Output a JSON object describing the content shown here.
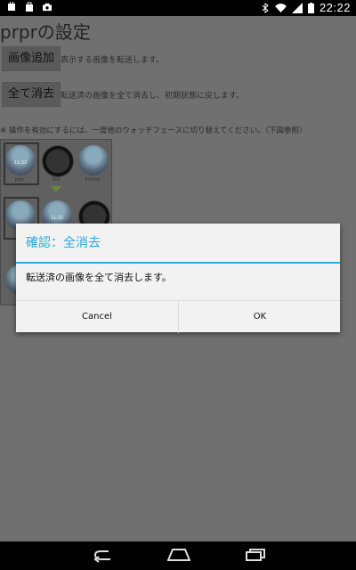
{
  "status_bar": {
    "time": "22:22",
    "left_icons": [
      "android-debug-icon",
      "shopping-bag-icon",
      "camera-icon"
    ],
    "right_icons": [
      "bluetooth-icon",
      "wifi-icon",
      "signal-icon",
      "battery-icon"
    ]
  },
  "app": {
    "title": "prprの設定",
    "show_button": {
      "label": "画像追加",
      "desc": "表示する画像を転送します。"
    },
    "clear_button": {
      "label": "全て消去",
      "desc": "転送済の画像を全て消去し、初期状態に戻します。"
    },
    "note": "※ 操作を有効にするには、一度他のウォッチフェースに切り替えてください。（下図参照）",
    "illustration": {
      "captions": [
        "prpr",
        "Roll",
        "Photos"
      ],
      "times": [
        "11:32",
        "11:32"
      ]
    }
  },
  "dialog": {
    "title": "確認：全消去",
    "message": "転送済の画像を全て消去します。",
    "cancel_label": "Cancel",
    "ok_label": "OK",
    "accent_color": "#29a9d6"
  },
  "nav_bar": {
    "icons": [
      "back-icon",
      "home-icon",
      "recents-icon"
    ]
  }
}
